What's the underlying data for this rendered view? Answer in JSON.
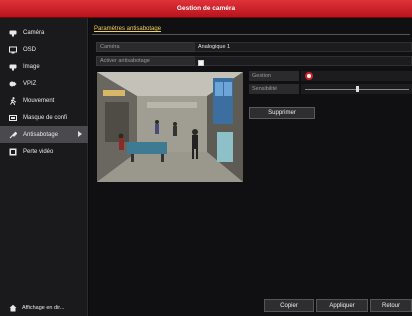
{
  "window": {
    "title": "Gestion de caméra"
  },
  "sidebar": {
    "items": [
      {
        "label": "Caméra",
        "icon": "camera-icon"
      },
      {
        "label": "OSD",
        "icon": "monitor-icon"
      },
      {
        "label": "Image",
        "icon": "image-icon"
      },
      {
        "label": "VPIZ",
        "icon": "ptz-icon"
      },
      {
        "label": "Mouvement",
        "icon": "motion-icon"
      },
      {
        "label": "Masque de confi",
        "icon": "mask-icon"
      },
      {
        "label": "Antisabotage",
        "icon": "tamper-icon",
        "active": true
      },
      {
        "label": "Perte vidéo",
        "icon": "video-loss-icon"
      }
    ],
    "footer": {
      "label": "Affichage en dir...",
      "icon": "home-icon"
    }
  },
  "section": {
    "title": "Paramètres antisabotage"
  },
  "form": {
    "camera_label": "Caméra",
    "camera_value": "Analogique 1",
    "enable_label": "Activer antisabotage",
    "enable_checked": true
  },
  "controls": {
    "handling_label": "Gestion",
    "sensitivity_label": "Sensibilité",
    "sensitivity_level": 0.5,
    "clear_label": "Supprimer"
  },
  "buttons": {
    "copy": "Copier",
    "apply": "Appliquer",
    "back": "Retour"
  },
  "colors": {
    "title_bar": "#c81c24",
    "accent_title": "#f0d060",
    "active_item": "#4a4a4e"
  }
}
